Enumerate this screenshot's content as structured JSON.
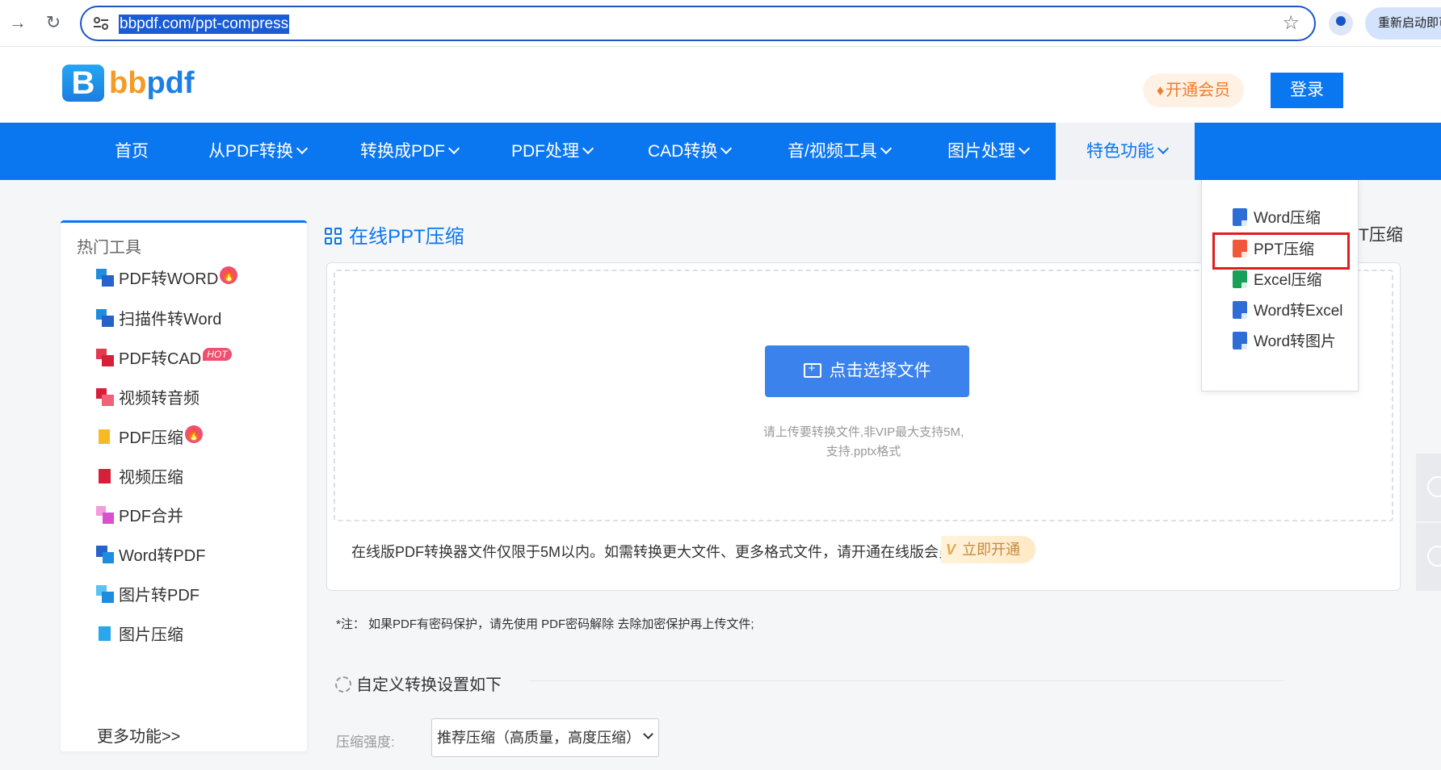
{
  "browser": {
    "url": "bbpdf.com/ppt-compress",
    "restart_label": "重新启动即可"
  },
  "header": {
    "logo_letter": "B",
    "logo_text_orange": "bb",
    "logo_text_blue": "pdf",
    "vip_label": "开通会员",
    "login_label": "登录"
  },
  "nav": {
    "items": [
      {
        "label": "首页"
      },
      {
        "label": "从PDF转换"
      },
      {
        "label": "转换成PDF"
      },
      {
        "label": "PDF处理"
      },
      {
        "label": "CAD转换"
      },
      {
        "label": "音/视频工具"
      },
      {
        "label": "图片处理"
      },
      {
        "label": "特色功能"
      }
    ]
  },
  "sidebar": {
    "title": "热门工具",
    "items": [
      {
        "label": "PDF转WORD",
        "badge": "fire"
      },
      {
        "label": "扫描件转Word"
      },
      {
        "label": "PDF转CAD",
        "badge": "HOT"
      },
      {
        "label": "视频转音频"
      },
      {
        "label": "PDF压缩",
        "badge": "fire"
      },
      {
        "label": "视频压缩"
      },
      {
        "label": "PDF合并"
      },
      {
        "label": "Word转PDF"
      },
      {
        "label": "图片转PDF"
      },
      {
        "label": "图片压缩"
      }
    ],
    "more": "更多功能>>"
  },
  "main": {
    "title": "在线PPT压缩",
    "right_fragment": "T压缩",
    "choose_button": "点击选择文件",
    "hint_line1": "请上传要转换文件,非VIP最大支持5M,",
    "hint_line2": "支持.pptx格式",
    "notice": "在线版PDF转换器文件仅限于5M以内。如需转换更大文件、更多格式文件，请开通在线版会员",
    "open_now": "立即开通",
    "note": "*注：  如果PDF有密码保护，请先使用 PDF密码解除 去除加密保护再上传文件;",
    "settings_title": "自定义转换设置如下",
    "compress_label": "压缩强度:",
    "compress_value": "推荐压缩（高质量，高度压缩）"
  },
  "dropdown": {
    "items": [
      {
        "label": "Word压缩",
        "type": "word"
      },
      {
        "label": "PPT压缩",
        "type": "ppt"
      },
      {
        "label": "Excel压缩",
        "type": "excel"
      },
      {
        "label": "Word转Excel",
        "type": "word"
      },
      {
        "label": "Word转图片",
        "type": "word"
      }
    ],
    "highlighted_index": 1
  },
  "colors": {
    "brand_blue": "#0a76f0",
    "highlight_red": "#e01e1e",
    "vip_orange": "#f07b2b"
  }
}
